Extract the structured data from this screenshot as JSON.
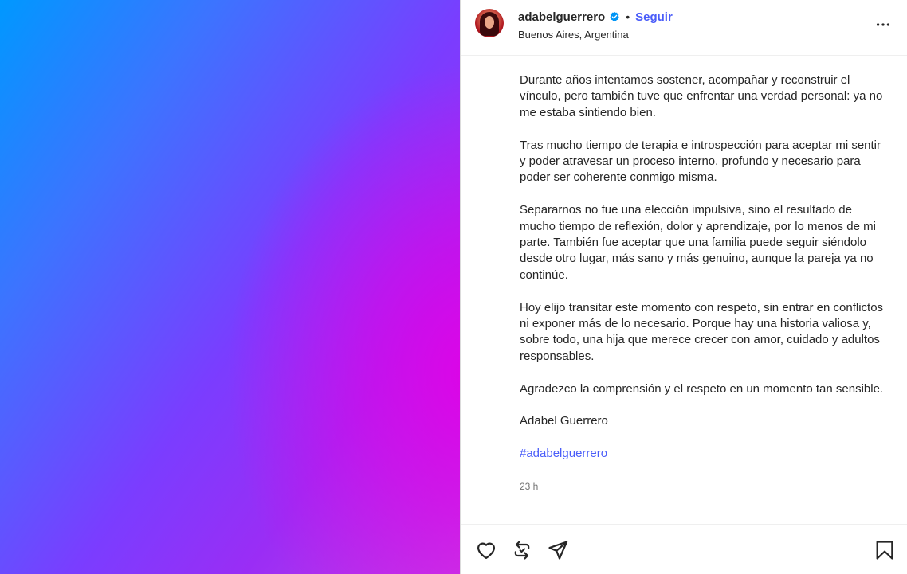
{
  "header": {
    "username": "adabelguerrero",
    "separator": "•",
    "follow_label": "Seguir",
    "location": "Buenos Aires, Argentina"
  },
  "caption": {
    "paragraphs": [
      "Durante años intentamos sostener, acompañar y reconstruir el vínculo, pero también tuve que enfrentar una verdad personal: ya no me estaba sintiendo bien.",
      "Tras mucho tiempo de terapia e introspección para aceptar mi sentir y poder atravesar un proceso interno, profundo y necesario para poder ser coherente conmigo misma.",
      "Separarnos no fue una elección impulsiva, sino el resultado de mucho tiempo de reflexión, dolor y aprendizaje, por lo menos de mi parte. También fue aceptar que una familia puede seguir siéndolo desde otro lugar, más sano y más genuino, aunque la pareja ya no continúe.",
      "Hoy elijo transitar este momento con respeto, sin entrar en conflictos ni exponer más de lo necesario. Porque hay una historia valiosa y, sobre todo, una hija que merece crecer con amor, cuidado y adultos responsables.",
      "Agradezco la comprensión y el respeto en un momento tan sensible.",
      "Adabel Guerrero"
    ],
    "hashtag": "#adabelguerrero",
    "timestamp": "23 h"
  },
  "icons": {
    "verified": "verified-badge-icon",
    "more": "more-options-icon",
    "like": "heart-icon",
    "repost": "repost-icon",
    "share": "send-icon",
    "save": "bookmark-icon"
  },
  "colors": {
    "accent": "#4a5df9",
    "text": "#262626",
    "muted": "#737373"
  }
}
